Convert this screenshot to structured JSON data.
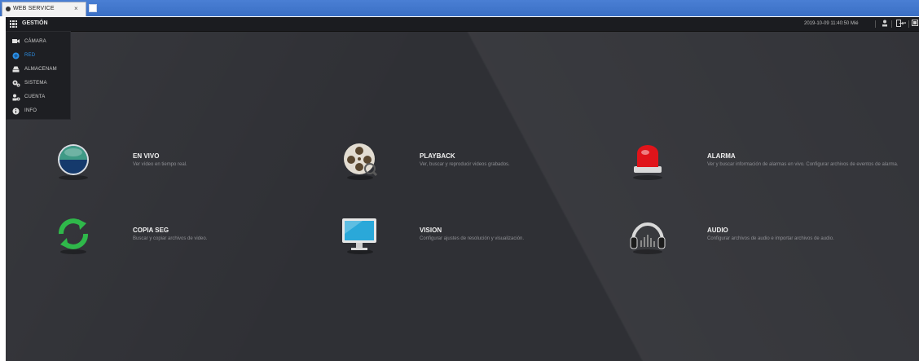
{
  "browser": {
    "tab_title": "WEB SERVICE",
    "tab_close": "×"
  },
  "topbar": {
    "title": "GESTIÓN",
    "datetime": "2019-10-09 11:40:50 Mié"
  },
  "menu": {
    "items": [
      {
        "label": "CÁMARA",
        "icon": "camera-icon",
        "active": false
      },
      {
        "label": "RED",
        "icon": "network-icon",
        "active": true
      },
      {
        "label": "ALMACENAM",
        "icon": "storage-icon",
        "active": false
      },
      {
        "label": "SISTEMA",
        "icon": "system-gear-icon",
        "active": false
      },
      {
        "label": "CUENTA",
        "icon": "account-icon",
        "active": false
      },
      {
        "label": "INFO",
        "icon": "info-icon",
        "active": false
      }
    ]
  },
  "tiles": [
    {
      "title": "EN VIVO",
      "desc": "Ver vídeo en tiempo real.",
      "icon": "live-view-icon"
    },
    {
      "title": "PLAYBACK",
      "desc": "Ver, buscar y reproducir videos grabados.",
      "icon": "playback-reel-icon"
    },
    {
      "title": "ALARMA",
      "desc": "Ver y buscar información de alarmas en vivo. Configurar archivos de eventos de alarma.",
      "icon": "alarm-light-icon"
    },
    {
      "title": "COPIA SEG",
      "desc": "Buscar y copiar archivos de video.",
      "icon": "backup-sync-icon"
    },
    {
      "title": "VISION",
      "desc": "Configurar ajustes de resolución y visualización.",
      "icon": "display-monitor-icon"
    },
    {
      "title": "AUDIO",
      "desc": "Configurar archivos de audio e importar archivos de audio.",
      "icon": "headphones-icon"
    }
  ],
  "colors": {
    "accent": "#2b8fe6",
    "background": "#2f3035",
    "topbar": "#1b1c20"
  }
}
